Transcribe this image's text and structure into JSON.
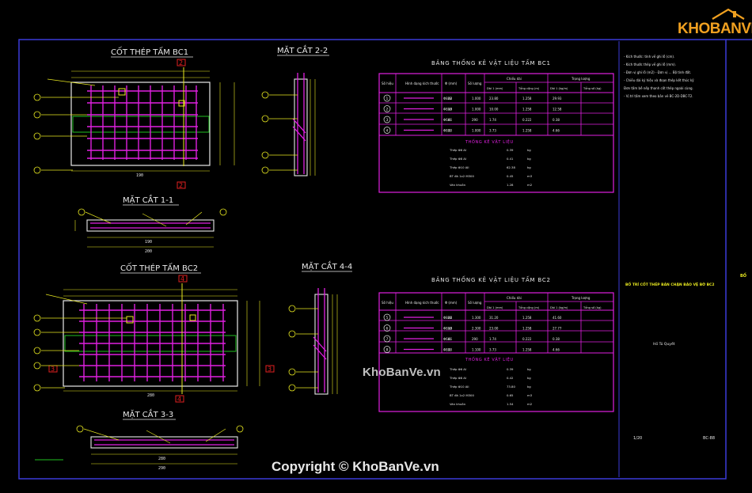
{
  "drawing": {
    "title_bc1": "CỐT THÉP TẤM BC1",
    "section_22": "MẶT CẮT 2-2",
    "section_11": "MẶT CẮT 1-1",
    "title_bc2": "CỐT THÉP TẤM BC2",
    "section_44": "MẶT CẮT 4-4",
    "section_33": "MẶT CẮT 3-3",
    "cut_2": "2",
    "cut_4": "4",
    "cut_3": "3",
    "dim_bc1_total": "190",
    "dim_11_a": "190",
    "dim_11_b": "200",
    "dim_bc2_total": "280",
    "dim_33_a": "280",
    "dim_33_b": "290",
    "table1_title": "BẢNG THỐNG KÊ VẬT LIỆU TẤM BC1",
    "table2_title": "BẢNG THỐNG KÊ VẬT LIỆU TẤM BC2",
    "headers": [
      "Số hiệu",
      "Hình dạng kích thước",
      "Φ (mm)",
      "Số lượng",
      "Chiều dài",
      "Trọng lượng"
    ],
    "subheaders": [
      "Dài 1 (mm)",
      "Tổng cộng (m)",
      "Dài 1 (kg/m)",
      "Tổng số (kg)"
    ],
    "mat_title": "THỐNG KÊ VẬT LIỆU",
    "t1_rows": [
      [
        "1",
        "Φ8A8",
        "22",
        "1.000",
        "23.80",
        "1.258",
        "29.93"
      ],
      [
        "2",
        "Φ8A8",
        "10",
        "1.000",
        "10.00",
        "1.258",
        "12.58"
      ],
      [
        "3",
        "Φ6A6",
        "6",
        "290",
        "1.74",
        "0.222",
        "0.38"
      ],
      [
        "4",
        "Φ8A8",
        "3",
        "1.000",
        "3.73",
        "1.258",
        "4.66"
      ]
    ],
    "t1_mat": [
      [
        "Thép Φ6 AI",
        "0.39",
        "kg"
      ],
      [
        "Thép Φ8 AI",
        "0.41",
        "kg"
      ],
      [
        "Thép Φ10 AII",
        "62.38",
        "kg"
      ],
      [
        "BT đá 1x2 M300",
        "0.45",
        "m3"
      ],
      [
        "Ván khuôn",
        "1.28",
        "m2"
      ]
    ],
    "t2_rows": [
      [
        "5",
        "Φ8A8",
        "24",
        "1.300",
        "31.20",
        "1.258",
        "41.60"
      ],
      [
        "6",
        "Φ8A8",
        "10",
        "2.300",
        "23.00",
        "1.258",
        "27.77"
      ],
      [
        "7",
        "Φ6A6",
        "6",
        "290",
        "1.74",
        "0.222",
        "0.38"
      ],
      [
        "8",
        "Φ8A8",
        "3",
        "1.100",
        "3.73",
        "1.258",
        "4.66"
      ]
    ],
    "t2_mat": [
      [
        "Thép Φ6 AI",
        "0.39",
        "kg"
      ],
      [
        "Thép Φ8 AI",
        "0.42",
        "kg"
      ],
      [
        "Thép Φ10 AII",
        "73.80",
        "kg"
      ],
      [
        "BT đá 1x2 M300",
        "0.65",
        "m3"
      ],
      [
        "Ván khuôn",
        "1.54",
        "m2"
      ]
    ],
    "notes": [
      "- Kích thước: tính về ghi lỗ (cm).",
      "- Kích thước thép về ghi lỗ (mm).",
      "- Đơn vị ghi lỗ (m2) - Đơn vị ... Bộ tính đất.",
      "- Chiều dài ký hiệu và đoạn thép kết thúc kỹ",
      "  Đơn tấm bê nếp thanh cốt thép ngoài cùng.",
      "- Vị trí tấm xem theo bản vẽ BC-2D-DBC-T2."
    ],
    "side_title": "BỐ TRÍ CỐT THÉP BẢN CHẶN BẢO VỆ BỜ BC2",
    "side_sub": "Hồ Tú Quyết",
    "scale": "1/20",
    "sheet": "BC-88",
    "right_cut": "BỐ"
  },
  "watermark": "KhoBanVe.vn",
  "copyright": "Copyright © KhoBanVe.vn",
  "logo": "KHOBANVE",
  "colors": {
    "background": "#000000",
    "frame": "#3a3ad8",
    "rebar": "#e020e0",
    "line": "#e8e8e8",
    "dim": "#e8e820",
    "concrete": "#20c020",
    "leader": "#e8e820",
    "table": "#e020e0",
    "cut": "#e02020"
  }
}
